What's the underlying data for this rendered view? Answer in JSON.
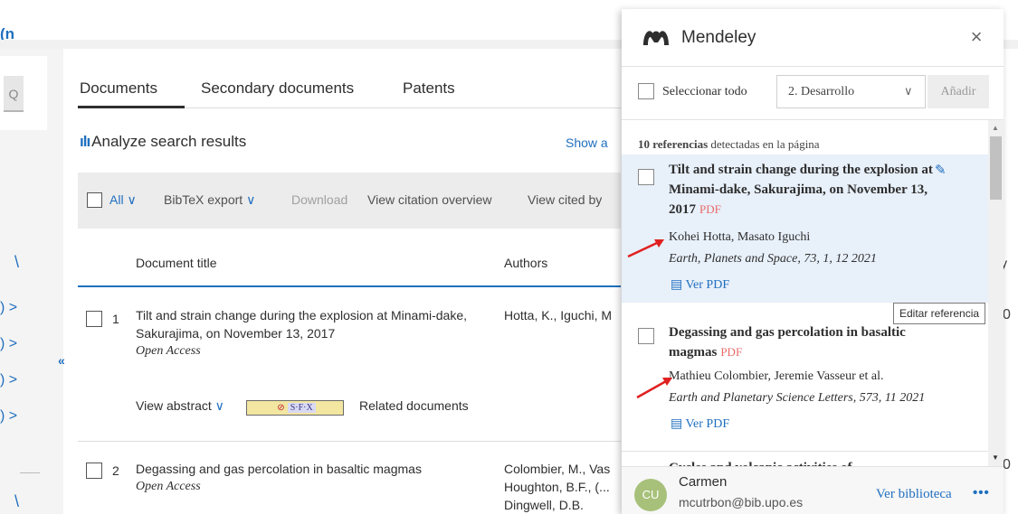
{
  "scopus": {
    "topbar_fragment": "(n",
    "tabs": [
      "Documents",
      "Secondary documents",
      "Patents"
    ],
    "analyze_label": "Analyze search results",
    "show_all_fragment": "Show a",
    "toolbar": {
      "all_label": "All",
      "bibtex_label": "BibTeX export",
      "download_label": "Download",
      "citation_overview_label": "View citation overview",
      "cited_by_label": "View cited by"
    },
    "columns": {
      "title": "Document title",
      "authors": "Authors",
      "edge_fragment": "y"
    },
    "rows": [
      {
        "num": "1",
        "title": "Tilt and strain change during the explosion at Minami-dake, Sakurajima, on November 13, 2017",
        "open_access": "Open Access",
        "authors_line1": "Hotta, K., Iguchi, M",
        "view_abstract": "View abstract",
        "sfx": "S·F·X",
        "related": "Related documents"
      },
      {
        "num": "2",
        "title": "Degassing and gas percolation in basaltic magmas",
        "open_access": "Open Access",
        "authors_line1": "Colombier, M., Vas",
        "authors_line2": "Houghton, B.F., (...",
        "authors_line3": "Dingwell, D.B."
      }
    ],
    "left_rows": [
      ") >",
      ") >",
      ") >",
      ") >"
    ],
    "right_edge": [
      "0",
      "0"
    ]
  },
  "mendeley": {
    "title": "Mendeley",
    "select_all_label": "Seleccionar todo",
    "folder_value": "2. Desarrollo",
    "add_label": "Añadir",
    "detected_count": "10 referencias",
    "detected_rest": " detectadas en la página",
    "references": [
      {
        "title": "Tilt and strain change during the explosion at Minami-dake, Sakurajima, on November 13, 2017",
        "pdf_tag": "PDF",
        "authors": "Kohei Hotta, Masato Iguchi",
        "journal": "Earth, Planets and Space",
        "details": ", 73, 1, 12 2021",
        "ver_pdf": "Ver PDF"
      },
      {
        "title": "Degassing and gas percolation in basaltic magmas",
        "pdf_tag": "PDF",
        "authors": "Mathieu Colombier, Jeremie Vasseur et al.",
        "journal": "Earth and Planetary Science Letters",
        "details": ", 573, 11 2021",
        "ver_pdf": "Ver PDF"
      },
      {
        "title": "Cycles and volcanic activities of"
      }
    ],
    "tooltip": "Editar referencia",
    "user": {
      "initials": "CU",
      "name": "Carmen",
      "email": "mcutrbon@bib.upo.es"
    },
    "library_link": "Ver biblioteca",
    "more": "•••"
  },
  "colors": {
    "link_blue": "#1f6fbf",
    "pdf_red": "#e86b6b",
    "highlight": "#e8f0fa",
    "arrow_red": "#e02020",
    "avatar_green": "#a7c17a"
  }
}
